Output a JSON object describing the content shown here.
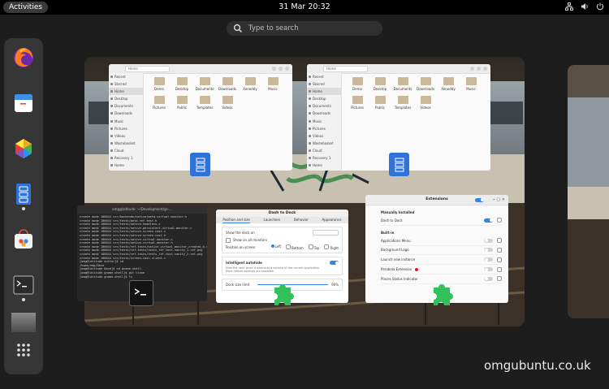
{
  "topbar": {
    "activities_label": "Activities",
    "clock": "31 Mar  20:32",
    "tray_icons": [
      "network-icon",
      "volume-icon",
      "power-icon"
    ]
  },
  "search": {
    "placeholder": "Type to search"
  },
  "dash": {
    "items": [
      {
        "name": "firefox",
        "running": false
      },
      {
        "name": "calendar",
        "running": false
      },
      {
        "name": "software",
        "running": false
      },
      {
        "name": "files",
        "running": true
      },
      {
        "name": "software-store",
        "running": false
      },
      {
        "name": "terminal",
        "running": true
      },
      {
        "name": "blank-app",
        "running": false
      },
      {
        "name": "show-apps",
        "running": false
      }
    ]
  },
  "files": {
    "sidebar": [
      "Recent",
      "Starred",
      "Home",
      "Desktop",
      "Documents",
      "Downloads",
      "Music",
      "Pictures",
      "Videos",
      "Wastebasket",
      "Cloud",
      "Recovery 1",
      "Home"
    ],
    "icons": [
      "Demo",
      "Desktop",
      "Documents",
      "Downloads",
      "Xenoddy",
      "Music",
      "Pictures",
      "Public",
      "Templates",
      "Videos"
    ],
    "path": "Home"
  },
  "terminal": {
    "title": "omg@latitude: ~/Development/gs-...",
    "lines": [
      "create mode 100644 src/backends/native/meta-virtual-monitor.h",
      "create mode 100644 src/tests/meta-ref-test.h",
      "create mode 100644 src/tests/native-headless.c",
      "create mode 100644 src/tests/native-persistent-virtual-monitor.c",
      "create mode 100644 src/tests/native-screen-cast.c",
      "create mode 100644 src/tests/native-screen-cast.h",
      "create mode 100644 src/tests/native-virtual-monitor.c",
      "create mode 100644 src/tests/native-virtual-monitor.h",
      "create mode 100644 src/tests/ref-tests/native_virtual_monitor_created_0.ref.png",
      "create mode 100644 src/tests/ref-tests/tests_ref-test-sanity_1.ref.png",
      "create mode 100644 src/tests/ref-tests/tests_ref-test-sanity_2.ref.png",
      "create mode 100644 src/tests/screen-cast-client.c",
      "[omg@latitude mutter]$ cd",
      "/home/omg/Deve",
      "[omg@latitude Deve]$ cd gnome-shell-",
      "[omg@latitude gnome-shell]$ git clone",
      "[omg@latitude gnome-shell]$ ls"
    ]
  },
  "dash_to_dock": {
    "title": "Dash to Dock",
    "tabs": [
      "Position and size",
      "Launchers",
      "Behavior",
      "Appearance"
    ],
    "show_dock_on": "Show the dock on",
    "all_monitors": "Show on all monitors",
    "position_label": "Position on screen",
    "positions": [
      "Left",
      "Bottom",
      "Top",
      "Right"
    ],
    "intellihide_title": "Intelligent autohide",
    "intellihide_desc": "Hide the dock when it obstructs a window of the current application. More refined settings are available.",
    "dock_size_label": "Dock size limit",
    "dock_size_value": "90%"
  },
  "extensions": {
    "title": "Extensions",
    "manually_installed": "Manually Installed",
    "manual": [
      {
        "name": "Dash to Dock",
        "enabled": true,
        "error": false
      }
    ],
    "built_in": "Built-in",
    "builtin_list": [
      {
        "name": "Applications Menu",
        "enabled": false,
        "error": false
      },
      {
        "name": "Background Logo",
        "enabled": false,
        "error": false
      },
      {
        "name": "Launch new instance",
        "enabled": false,
        "error": false
      },
      {
        "name": "Parabola Extension",
        "enabled": false,
        "error": true
      },
      {
        "name": "Places Status Indicator",
        "enabled": false,
        "error": false
      }
    ],
    "accent": "#3584e4",
    "error_color": "#e01b24"
  },
  "watermark": "omgubuntu.co.uk"
}
